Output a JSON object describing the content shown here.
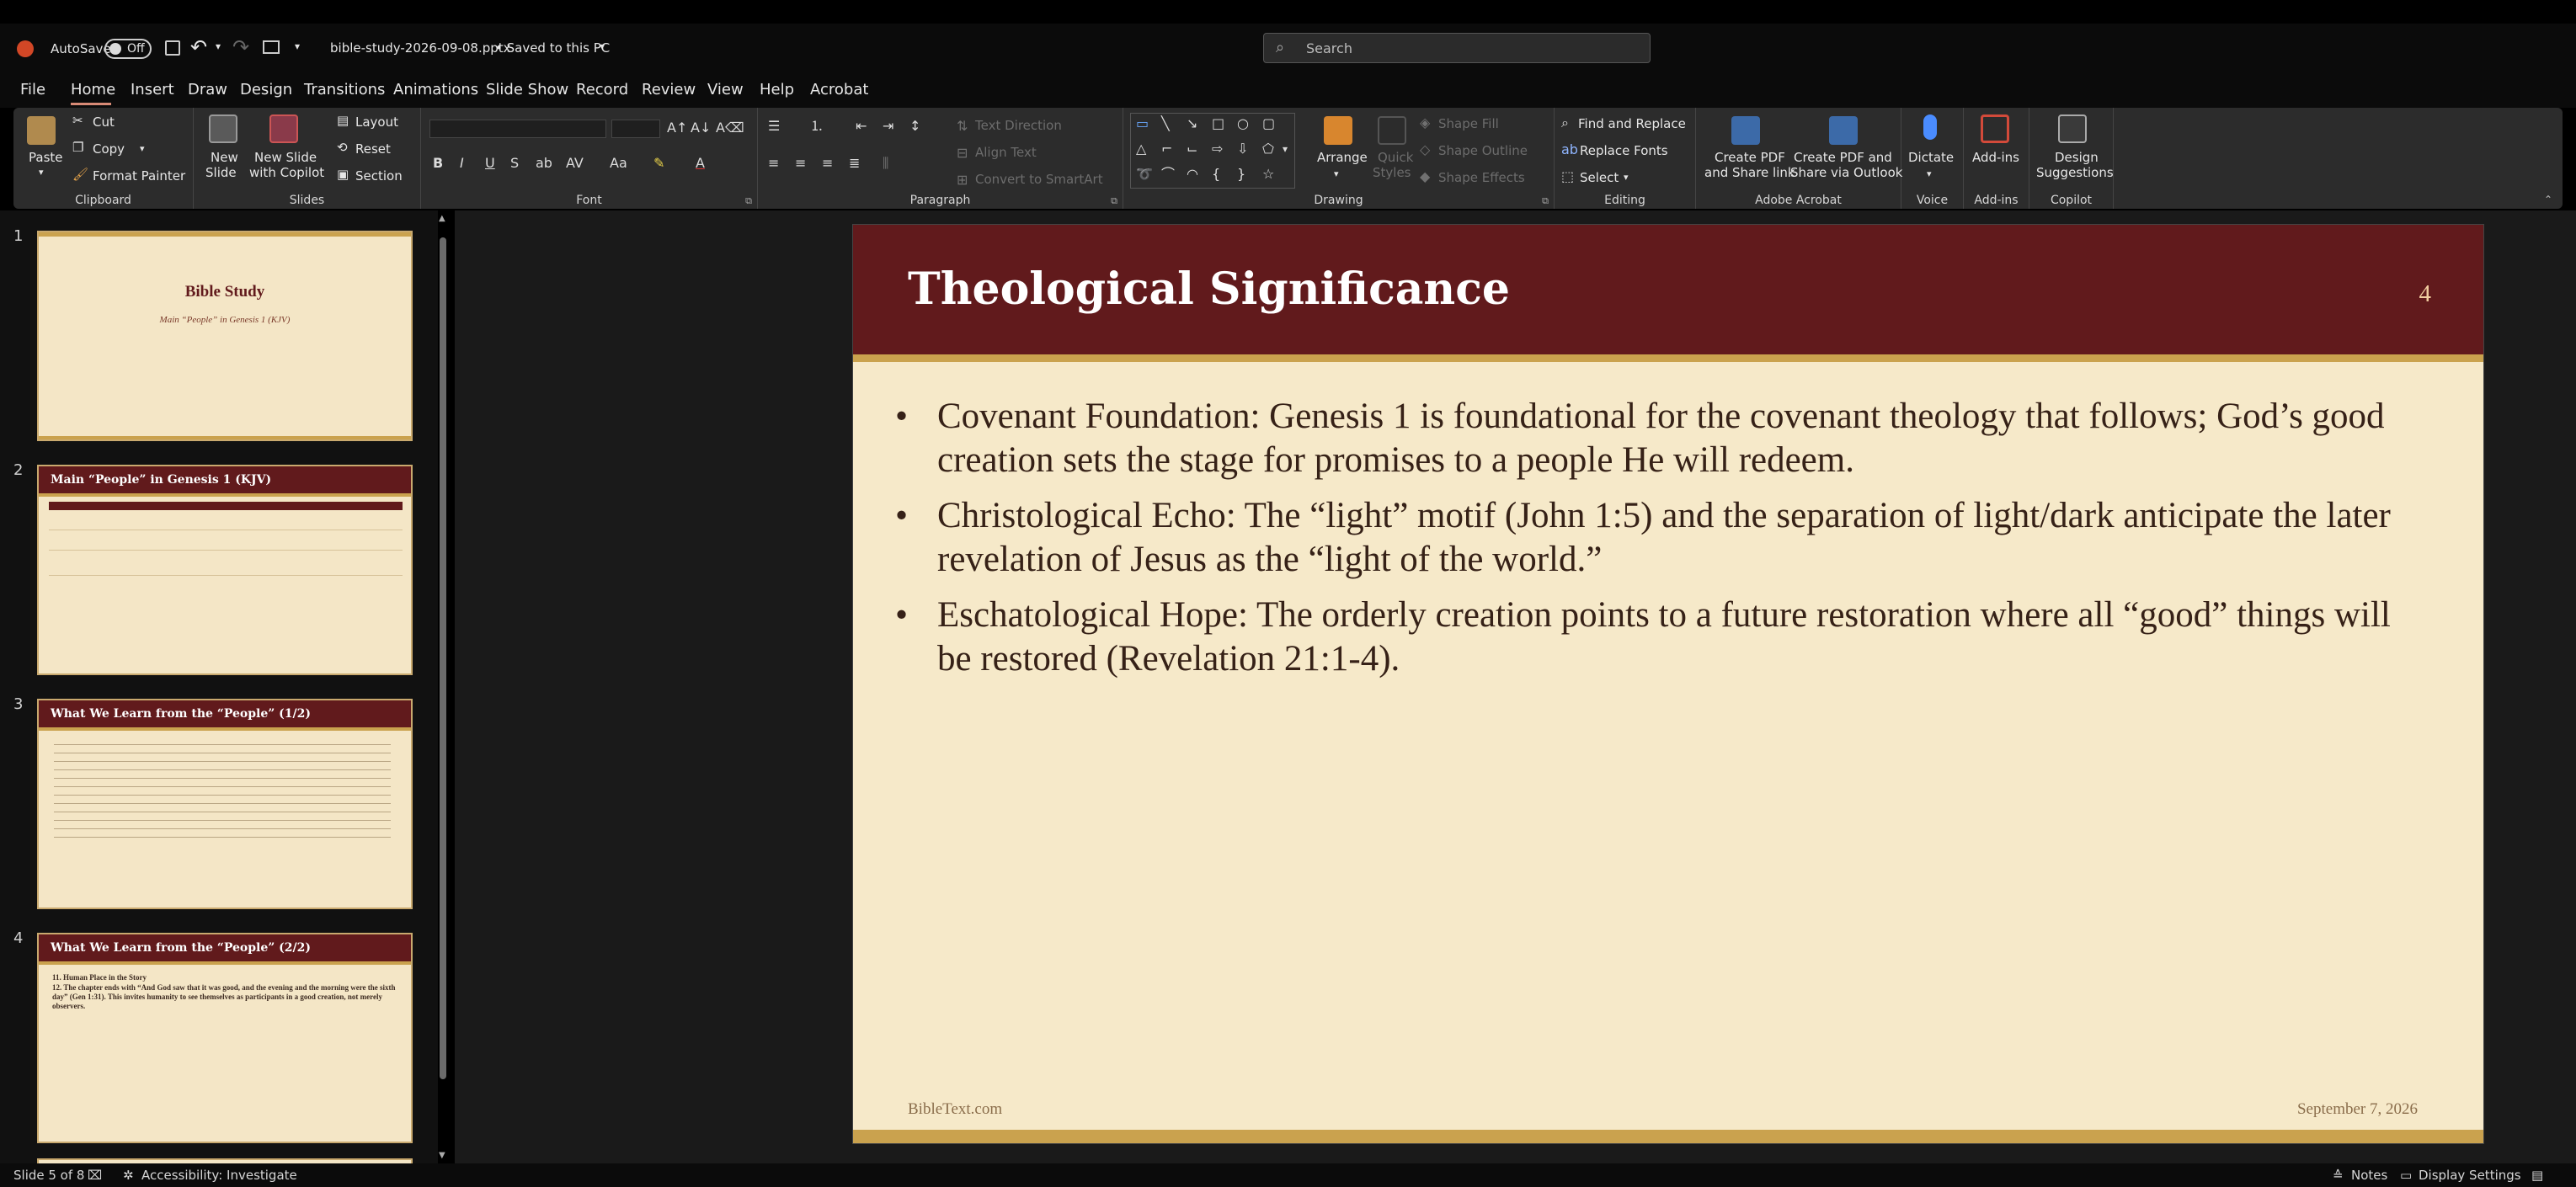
{
  "titlebar": {
    "autosave_label": "AutoSave",
    "autosave_state": "Off",
    "filename": "bible-study-2026-09-08.pptx",
    "save_status": "• Saved to this PC",
    "search_placeholder": "Search"
  },
  "menu": [
    "File",
    "Home",
    "Insert",
    "Draw",
    "Design",
    "Transitions",
    "Animations",
    "Slide Show",
    "Record",
    "Review",
    "View",
    "Help",
    "Acrobat"
  ],
  "ribbon": {
    "clipboard": {
      "paste": "Paste",
      "cut": "Cut",
      "copy": "Copy",
      "format_painter": "Format Painter",
      "label": "Clipboard"
    },
    "slides": {
      "new_slide_1": "New",
      "new_slide_2": "Slide",
      "new_copilot_1": "New Slide",
      "new_copilot_2": "with Copilot",
      "layout": "Layout",
      "reset": "Reset",
      "section": "Section",
      "label": "Slides"
    },
    "font": {
      "label": "Font"
    },
    "paragraph": {
      "text_direction": "Text Direction",
      "align_text": "Align Text",
      "smartart": "Convert to SmartArt",
      "label": "Paragraph"
    },
    "drawing": {
      "arrange": "Arrange",
      "quick_styles_1": "Quick",
      "quick_styles_2": "Styles",
      "shape_fill": "Shape Fill",
      "shape_outline": "Shape Outline",
      "shape_effects": "Shape Effects",
      "label": "Drawing"
    },
    "editing": {
      "find_replace": "Find and Replace",
      "replace_fonts": "Replace Fonts",
      "select": "Select",
      "label": "Editing"
    },
    "acrobat": {
      "pdf_share_1": "Create PDF",
      "pdf_share_2": "and Share link",
      "pdf_outlook_1": "Create PDF and",
      "pdf_outlook_2": "Share via Outlook",
      "label": "Adobe Acrobat"
    },
    "voice": {
      "dictate": "Dictate",
      "label": "Voice"
    },
    "addins": {
      "addins": "Add-ins",
      "label": "Add-ins"
    },
    "copilot": {
      "design_1": "Design",
      "design_2": "Suggestions",
      "label": "Copilot"
    }
  },
  "thumbnails": {
    "nums": [
      "1",
      "2",
      "3",
      "4"
    ],
    "t1_title": "Bible Study",
    "t1_sub": "Main “People” in Genesis 1 (KJV)",
    "t2_title": "Main “People” in Genesis 1 (KJV)",
    "t3_title": "What We Learn from the “People” (1/2)",
    "t4_title": "What We Learn from the “People” (2/2)",
    "t4_line1": "11. Human Place in the Story",
    "t4_line2": "12. The chapter ends with “And God saw that it was good, and the evening and the morning were the sixth day” (Gen 1:31). This invites humanity to see themselves as participants in a good creation, not merely observers."
  },
  "slide": {
    "title": "Theological Significance",
    "number": "4",
    "bullets": [
      "Covenant Foundation: Genesis 1 is foundational for the covenant theology that follows; God’s good creation sets the stage for promises to a people He will redeem.",
      "Christological Echo: The “light” motif (John 1:5) and the separation of light/dark anticipate the later revelation of Jesus as the “light of the world.”",
      "Eschatological Hope: The orderly creation points to a future restoration where all “good” things will be restored (Revelation 21:1-4)."
    ],
    "footer_left": "BibleText.com",
    "footer_right": "September 7, 2026"
  },
  "status": {
    "slide_count": "Slide 5 of 8",
    "accessibility": "Accessibility: Investigate",
    "notes": "Notes",
    "display_settings": "Display Settings"
  },
  "colors": {
    "header": "#611a1c",
    "gold": "#caa24e",
    "slide_bg": "#f6e9c9"
  }
}
